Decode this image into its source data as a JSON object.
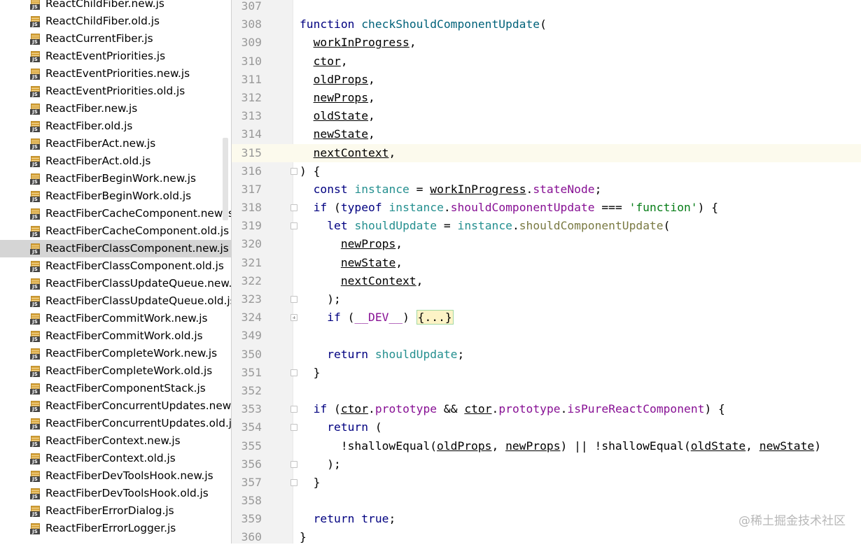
{
  "project_tree": {
    "files": [
      "ReactChildFiber.new.js",
      "ReactChildFiber.old.js",
      "ReactCurrentFiber.js",
      "ReactEventPriorities.js",
      "ReactEventPriorities.new.js",
      "ReactEventPriorities.old.js",
      "ReactFiber.new.js",
      "ReactFiber.old.js",
      "ReactFiberAct.new.js",
      "ReactFiberAct.old.js",
      "ReactFiberBeginWork.new.js",
      "ReactFiberBeginWork.old.js",
      "ReactFiberCacheComponent.new.js",
      "ReactFiberCacheComponent.old.js",
      "ReactFiberClassComponent.new.js",
      "ReactFiberClassComponent.old.js",
      "ReactFiberClassUpdateQueue.new.js",
      "ReactFiberClassUpdateQueue.old.js",
      "ReactFiberCommitWork.new.js",
      "ReactFiberCommitWork.old.js",
      "ReactFiberCompleteWork.new.js",
      "ReactFiberCompleteWork.old.js",
      "ReactFiberComponentStack.js",
      "ReactFiberConcurrentUpdates.new.js",
      "ReactFiberConcurrentUpdates.old.js",
      "ReactFiberContext.new.js",
      "ReactFiberContext.old.js",
      "ReactFiberDevToolsHook.new.js",
      "ReactFiberDevToolsHook.old.js",
      "ReactFiberErrorDialog.js",
      "ReactFiberErrorLogger.js"
    ],
    "selected_file": "ReactFiberClassComponent.new.js",
    "file_icon": "js-file-icon"
  },
  "editor": {
    "current_line": "315",
    "line_numbers": [
      "307",
      "308",
      "309",
      "310",
      "311",
      "312",
      "313",
      "314",
      "315",
      "316",
      "317",
      "318",
      "319",
      "320",
      "321",
      "322",
      "323",
      "324",
      "349",
      "350",
      "351",
      "352",
      "353",
      "354",
      "355",
      "356",
      "357",
      "358",
      "359",
      "360"
    ],
    "folded_placeholder": "{...}"
  },
  "watermark": "@稀土掘金技术社区"
}
